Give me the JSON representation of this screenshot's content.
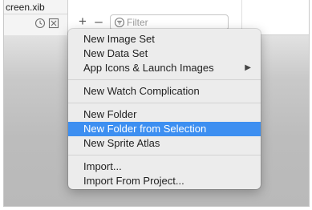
{
  "file_pane": {
    "file_name": "creen.xib",
    "icons": [
      "clock-icon",
      "close-box-icon"
    ]
  },
  "toolbar": {
    "add_label": "+",
    "remove_label": "–",
    "filter_placeholder": "Filter"
  },
  "menu": {
    "highlight_color": "#3d8ff1",
    "groups": [
      {
        "items": [
          {
            "label": "New Image Set"
          },
          {
            "label": "New Data Set"
          },
          {
            "label": "App Icons & Launch Images",
            "submenu": true,
            "arrow": "▶"
          }
        ]
      },
      {
        "items": [
          {
            "label": "New Watch Complication"
          }
        ]
      },
      {
        "items": [
          {
            "label": "New Folder"
          },
          {
            "label": "New Folder from Selection",
            "highlighted": true
          },
          {
            "label": "New Sprite Atlas"
          }
        ]
      },
      {
        "items": [
          {
            "label": "Import..."
          },
          {
            "label": "Import From Project..."
          }
        ]
      }
    ]
  }
}
